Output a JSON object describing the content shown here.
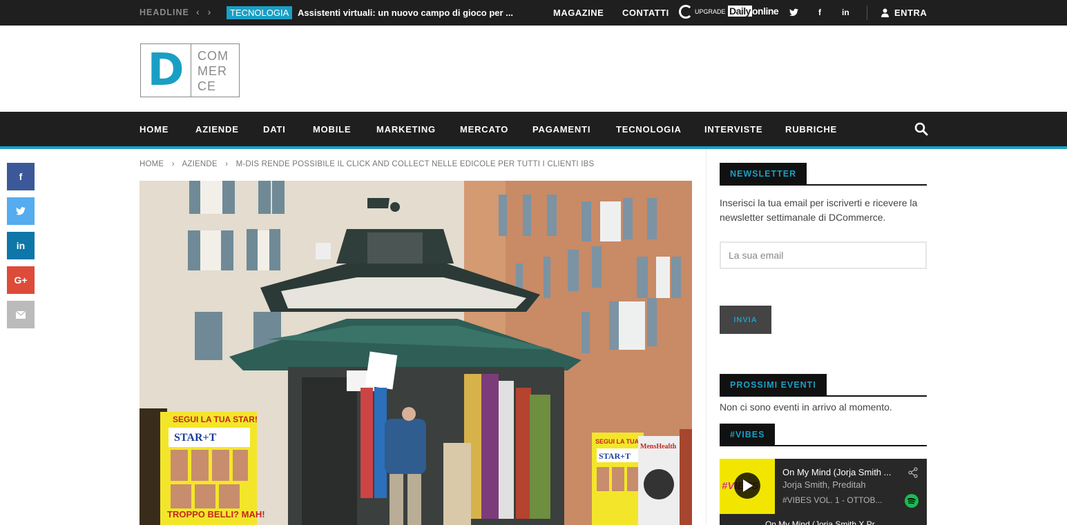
{
  "topbar": {
    "headline_label": "HEADLINE",
    "prev_arrow": "‹",
    "next_arrow": "›",
    "category": "TECNOLOGIA",
    "headline_title": "Assistenti virtuali: un nuovo campo di gioco per ...",
    "links": [
      "MAGAZINE",
      "CONTATTI"
    ],
    "upgrade_label": "UPGRADE",
    "daily_brand_a": "Daily",
    "daily_brand_b": "online",
    "login_label": "ENTRA"
  },
  "logo": {
    "letter": "D",
    "line1": "COM",
    "line2": "MER",
    "line3": "CE"
  },
  "nav": {
    "items": [
      "HOME",
      "AZIENDE",
      "DATI",
      "MOBILE",
      "MARKETING",
      "MERCATO",
      "PAGAMENTI",
      "TECNOLOGIA",
      "INTERVISTE",
      "RUBRICHE"
    ]
  },
  "social_side": {
    "facebook": "f",
    "linkedin": "in",
    "googleplus": "G+"
  },
  "breadcrumb": {
    "home": "HOME",
    "sep": "›",
    "category": "AZIENDE",
    "current": "M-DIS RENDE POSSIBILE IL CLICK AND COLLECT NELLE EDICOLE PER TUTTI I CLIENTI IBS"
  },
  "photo": {
    "poster_left_top": "SEGUI LA TUA STAR!",
    "poster_left_brand": "STAR+T",
    "poster_left_bottom": "TROPPO BELLI? MAH!",
    "poster_right_top": "SEGUI LA TUA STAR!",
    "poster_right_brand": "STAR+T",
    "poster_far_right": "MensHealth"
  },
  "sidebar": {
    "newsletter_title": "NEWSLETTER",
    "newsletter_text": "Inserisci la tua email per iscriverti e ricevere la newsletter settimanale di DCommerce.",
    "email_placeholder": "La sua email",
    "submit_label": "INVIA",
    "events_title": "PROSSIMI EVENTI",
    "events_text": "Non ci sono eventi in arrivo al momento.",
    "vibes_title": "#VIBES"
  },
  "spotify": {
    "art_text": "#VIBES",
    "track_title": "On My Mind (Jorja Smith ...",
    "artist": "Jorja Smith, Preditah",
    "album": "#VIBES VOL. 1 - OTTOB...",
    "row_title": "On My Mind (Jorja Smith X Pr..."
  },
  "colors": {
    "accent": "#1a9fc4",
    "dark": "#1f1f1f",
    "facebook": "#3b5998",
    "twitter": "#55acee",
    "linkedin": "#0e76a8",
    "googleplus": "#dd4b39",
    "email": "#bbbbbb",
    "spotify_green": "#1db954"
  }
}
